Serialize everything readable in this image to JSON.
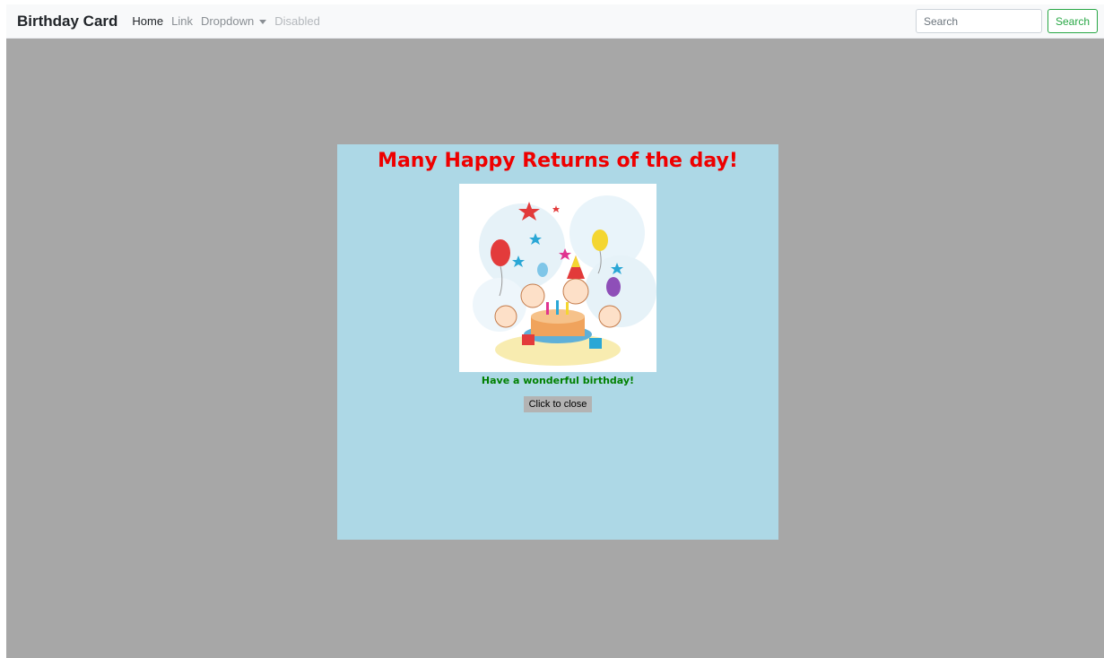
{
  "navbar": {
    "brand": "Birthday Card",
    "links": [
      {
        "label": "Home"
      },
      {
        "label": "Link"
      },
      {
        "label": "Dropdown"
      },
      {
        "label": "Disabled"
      }
    ],
    "search": {
      "placeholder": "Search",
      "button_label": "Search"
    }
  },
  "card": {
    "title": "Many Happy Returns of the day!",
    "message": "Have a wonderful birthday!",
    "close_label": "Click to close"
  },
  "colors": {
    "overlay": "#a7a7a7",
    "card_background": "#add8e6",
    "title": "#ee0000",
    "message": "#008000",
    "search_accent": "#28a745"
  }
}
